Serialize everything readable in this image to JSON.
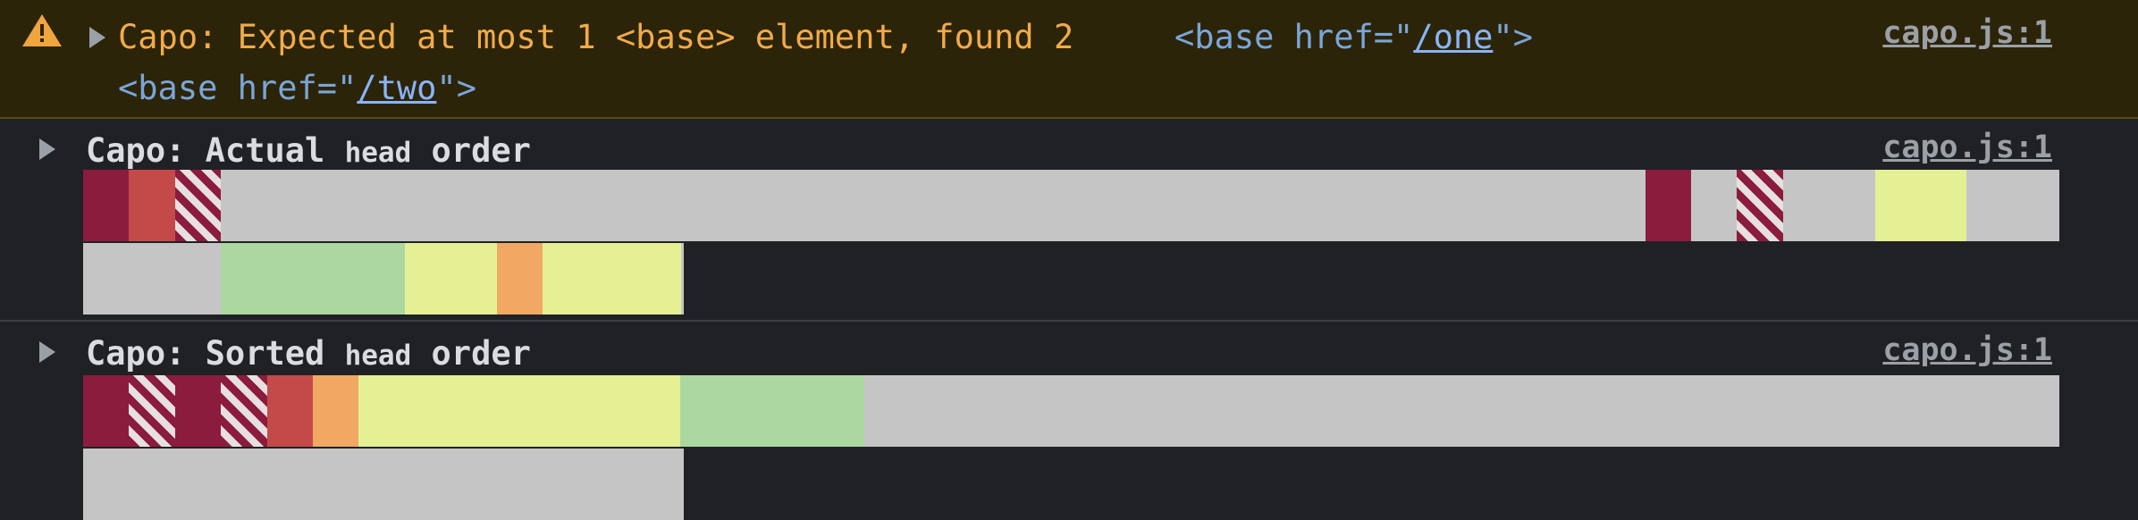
{
  "warning": {
    "icon": "warning-icon",
    "icon_color": "#f1a53d",
    "message": "Capo: Expected at most 1 <base> element, found 2",
    "base_one": {
      "open": "<base href=\"",
      "href": "/one",
      "close": "\">"
    },
    "base_two": {
      "open": "<base href=\"",
      "href": "/two",
      "close": "\">"
    },
    "source": "capo.js:1"
  },
  "actual": {
    "title_prefix": "Capo: Actual ",
    "title_code": "head",
    "title_suffix": " order",
    "source": "capo.js:1",
    "segments": [
      "dark",
      "red",
      "stripe",
      "gray",
      "gray",
      "gray",
      "gray",
      "gray",
      "gray",
      "gray",
      "gray",
      "gray",
      "gray",
      "gray",
      "gray",
      "gray",
      "gray",
      "gray",
      "gray",
      "gray",
      "gray",
      "gray",
      "gray",
      "gray",
      "gray",
      "gray",
      "gray",
      "gray",
      "gray",
      "gray",
      "gray",
      "gray",
      "gray",
      "gray",
      "dark",
      "gray",
      "stripe",
      "gray",
      "gray",
      "yellow",
      "yellow",
      "gray",
      "gray",
      "gray",
      "gray",
      "gray",
      "green",
      "green",
      "green",
      "green",
      "yellow",
      "yellow",
      "orange",
      "yellow",
      "yellow",
      "yellow"
    ]
  },
  "sorted": {
    "title_prefix": "Capo: Sorted ",
    "title_code": "head",
    "title_suffix": " order",
    "source": "capo.js:1",
    "segments": [
      "dark",
      "stripe",
      "dark",
      "stripe",
      "red",
      "orange",
      "yellow",
      "yellow",
      "yellow",
      "yellow",
      "yellow",
      "yellow",
      "yellow",
      "green",
      "green",
      "green",
      "green",
      "gray",
      "gray",
      "gray",
      "gray",
      "gray",
      "gray",
      "gray",
      "gray",
      "gray",
      "gray",
      "gray",
      "gray",
      "gray",
      "gray",
      "gray",
      "gray",
      "gray",
      "gray",
      "gray",
      "gray",
      "gray",
      "gray",
      "gray",
      "gray",
      "gray",
      "gray",
      "gray",
      "gray",
      "gray",
      "gray",
      "gray",
      "gray",
      "gray",
      "gray",
      "gray",
      "gray",
      "gray",
      "gray",
      "gray"
    ]
  },
  "colors": {
    "dark": "#8b1c3e",
    "red": "#c44a4a",
    "green": "#add7a0",
    "yellow": "#e4f093",
    "orange": "#f0a863",
    "gray": "#c5c5c5"
  }
}
